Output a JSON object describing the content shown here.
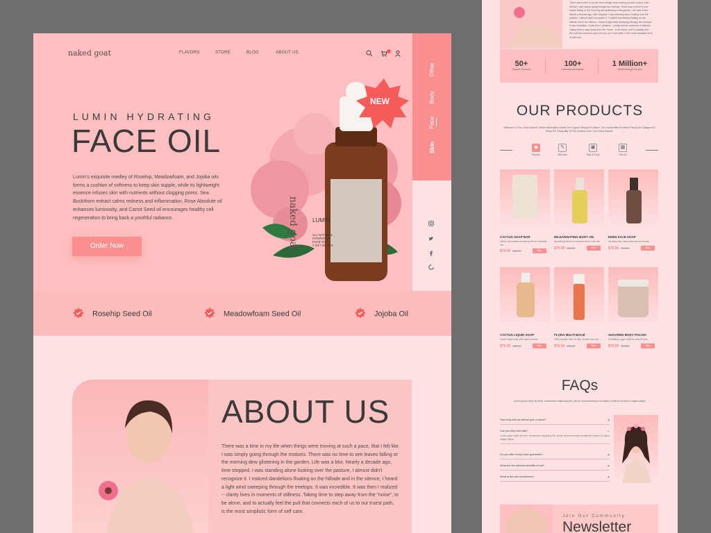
{
  "header": {
    "logo": "naked goat",
    "nav": [
      "FLAVORS",
      "STORE",
      "BLOG",
      "ABOUT US"
    ],
    "icons": [
      "search-icon",
      "cart-icon",
      "user-icon"
    ]
  },
  "sidebar": {
    "tabs": [
      "Other",
      "Body",
      "Face",
      "Skin"
    ],
    "active": "Skin"
  },
  "social": [
    "instagram-icon",
    "twitter-icon",
    "facebook-icon",
    "pinterest-icon"
  ],
  "hero": {
    "subtitle": "LUMIN HYDRATING",
    "title": "FACE OIL",
    "description": "Lumin's exquisite medley of Rosehip, Meadowfoam, and Jojoba oils forms a cushion of softness to keep skin supple, while its lightweight essence infuses skin with nutrients without clogging pores. Sea Buckthorn extract calms redness and inflammation, Rose Absolute oil enhances luminosity, and Carrot Seed oil encourages healthy cell regeneration to bring back a youthful radiance.",
    "cta": "Order Now",
    "badge": "NEW",
    "bottle": {
      "brand": "naked goat",
      "name": "LUMIN",
      "line1": "ALL NATURAL",
      "line2": "HYDRATING",
      "line3": "FACE OIL",
      "size": "1 OZ / 28.34 G"
    }
  },
  "benefits": [
    "Rosehip Seed Oil",
    "Meadowfoam Seed Oil",
    "Jojoba Oil"
  ],
  "about": {
    "title": "ABOUT US",
    "text": "There was a time in my life when things were moving at such a pace, that I felt like I was simply going through the motions. There was no time to see leaves falling or the morning dew glistening in the garden. Life was a blur. Nearly a decade ago, time stopped. I was standing alone looking over the pasture, I almost didn't recognize it. I noticed dandelions floating on the hillside and in the silence, I heard a light wind sweeping through the treetops. It was incredible. It was then I realized -- clarity lives in moments of stillness. Taking time to step away from the \"noise\", to be alone, and to actually feel the pull that connects each of us to our truest path, is the most simplistic form of self care."
  },
  "right": {
    "stats": [
      {
        "num": "50+",
        "label": "Organic Products"
      },
      {
        "num": "100+",
        "label": "International Awards"
      },
      {
        "num": "1 Million+",
        "label": "Saved through our box"
      }
    ],
    "products_title": "OUR PRODUCTS",
    "products_sub": "Welcome To Your Store Named, Where Minimalism Meets The Organic Beauty Of Nature. Our Handcrafted Furniture Pieces Are Designed To Bring The Tranquility Of The Outdoors Into Your Living Spaces.",
    "categories": [
      "Popular",
      "Skincare",
      "Hair & Body",
      "See All"
    ],
    "products": [
      {
        "name": "CACTUS SOAP BAR",
        "desc": "Gentle plant-based cleansing bar for everyday use.",
        "price": "$75.00",
        "old": "$85.00",
        "buy": "Buy"
      },
      {
        "name": "REJUVENATING BODY OIL",
        "desc": "Nourishing blend of botanical oils for soft skin.",
        "price": "$75.00",
        "old": "$85.00",
        "buy": "Buy"
      },
      {
        "name": "EDEN FACE SOAP",
        "desc": "Soothing face wash with natural extracts.",
        "price": "$75.00",
        "old": "$80.00",
        "buy": "Buy"
      },
      {
        "name": "CACTUS LIQUID SOAP",
        "desc": "Gentle liquid soap with cactus extract.",
        "price": "$75.00",
        "old": "$85.00",
        "buy": "Buy"
      },
      {
        "name": "FLORA MULTI-BALM",
        "desc": "Multi-purpose balm for lips, cheeks and skin.",
        "price": "$75.00",
        "old": "$85.00",
        "buy": "Buy"
      },
      {
        "name": "SUGARED BODY POLISH",
        "desc": "Exfoliating sugar scrub for smooth skin.",
        "price": "$75.00",
        "old": "$80.00",
        "buy": "Buy"
      }
    ],
    "faq_title": "FAQs",
    "faq_sub": "Lorem ipsum dolor sit amet, consectetur adipiscing elit, sed do eiusmod tempor incididunt ut labore et dolore magna aliqua.",
    "faqs": [
      {
        "q": "How long until we deliver your product?",
        "a": ""
      },
      {
        "q": "Can you ship internally?",
        "a": "Lorem ipsum dolor sit amet, consectetur adipiscing elit, sed do eiusmod tempor incididunt ut labore et dolore magna aliqua."
      },
      {
        "q": "Do you offer money back guarantee?",
        "a": ""
      },
      {
        "q": "What are the skincare benefits of oat?",
        "a": ""
      },
      {
        "q": "What is the skin microbiome?",
        "a": ""
      }
    ],
    "news_sub": "Join Our Community",
    "news_title": "Newsletter"
  }
}
